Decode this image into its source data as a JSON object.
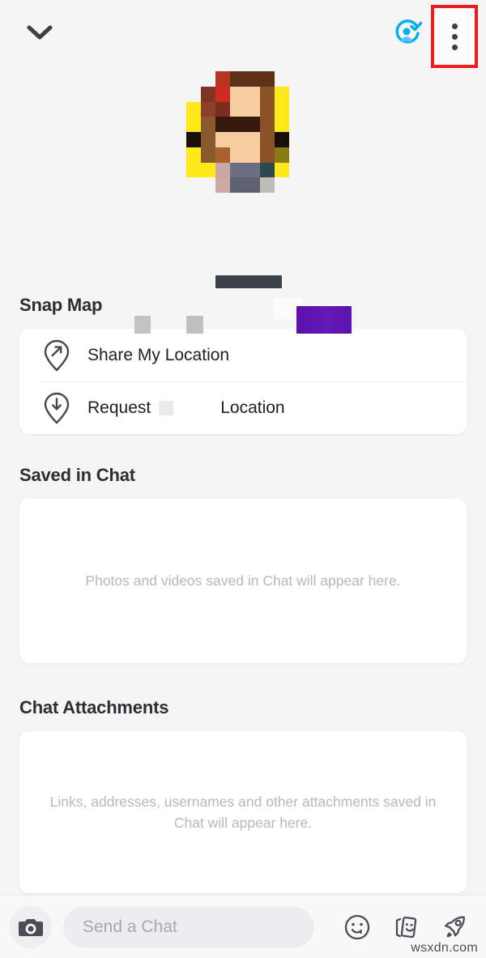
{
  "header": {
    "collapse_icon": "chevron-down-icon",
    "friend_status_icon": "friend-added-verified-icon",
    "more_options_icon": "kebab-menu-icon",
    "highlight_color": "#ee1c1c"
  },
  "profile": {
    "avatar_alt": "pixelated-bitmoji-avatar",
    "display_name_redacted": "",
    "username_redacted": "",
    "badge_redacted": ""
  },
  "sections": {
    "snap_map": {
      "title": "Snap Map",
      "rows": [
        {
          "icon": "location-pin-share-icon",
          "label": "Share My Location",
          "redacted_name": false
        },
        {
          "icon": "location-pin-request-icon",
          "label_before": "Request",
          "label_after": "Location",
          "redacted_name": true
        }
      ]
    },
    "saved_in_chat": {
      "title": "Saved in Chat",
      "empty_text": "Photos and videos saved in Chat will appear here."
    },
    "chat_attachments": {
      "title": "Chat Attachments",
      "empty_text": "Links, addresses, usernames and other attachments saved in Chat will appear here."
    }
  },
  "chatbar": {
    "camera_icon": "camera-icon",
    "input_placeholder": "Send a Chat",
    "input_value": "",
    "sticker_icon": "smiley-sticker-icon",
    "cards_icon": "bitmoji-cards-icon",
    "rocket_icon": "rocket-send-icon"
  },
  "watermark": "wsxdn.com",
  "avatar_pixels": [
    [
      "#f5f5f6",
      "#f5f5f6",
      "#b5361f",
      "#5d3118",
      "#5d3118",
      "#5d3118",
      "#f5f5f6",
      "#f5f5f6"
    ],
    [
      "#f5f5f6",
      "#7e3526",
      "#cc2a22",
      "#f6cd9f",
      "#f6cd9f",
      "#8a5226",
      "#ffe81a",
      "#f5f5f6"
    ],
    [
      "#ffe81a",
      "#8c3f2a",
      "#7d2b1c",
      "#f6cd9f",
      "#f6cd9f",
      "#8a5226",
      "#ffe81a",
      "#f5f5f6"
    ],
    [
      "#ffe81a",
      "#8a5a2e",
      "#35180e",
      "#35180e",
      "#35180e",
      "#8a5226",
      "#ffe81a",
      "#f5f5f6"
    ],
    [
      "#1a0f08",
      "#8a5a2e",
      "#f6cd9f",
      "#f6cd9f",
      "#f6cd9f",
      "#8a5226",
      "#1a0f08",
      "#f5f5f6"
    ],
    [
      "#ffe81a",
      "#8a5a2e",
      "#a8622c",
      "#f6cd9f",
      "#f6cd9f",
      "#8a5226",
      "#8a7a14",
      "#f5f5f6"
    ],
    [
      "#ffe81a",
      "#ffe81a",
      "#c9a7a3",
      "#6a6e82",
      "#6a6e82",
      "#2c4a4c",
      "#ffe81a",
      "#f5f5f6"
    ],
    [
      "#f5f5f6",
      "#f5f5f6",
      "#ceaaa6",
      "#5f6070",
      "#5f6070",
      "#bfbcb8",
      "#f5f5f6",
      "#f5f5f6"
    ]
  ]
}
